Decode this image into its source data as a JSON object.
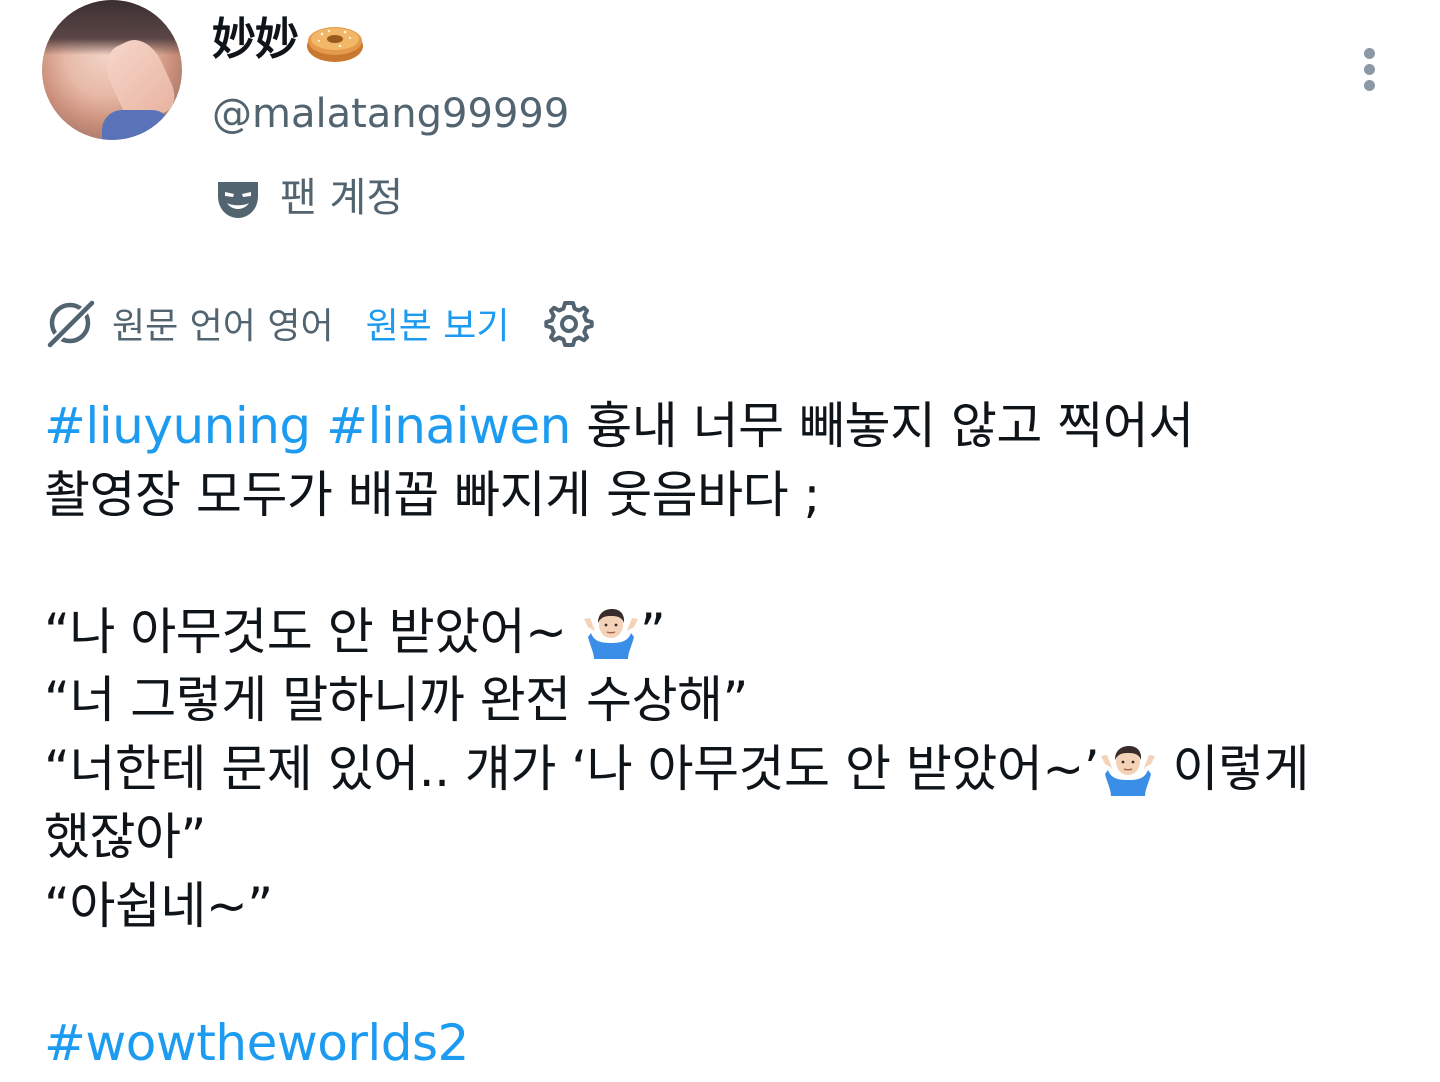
{
  "user": {
    "display_name": "妙妙",
    "display_name_emoji": "bagel-emoji",
    "handle": "@malatang99999",
    "badge_label": "팬 계정"
  },
  "translation": {
    "source_language": "원문 언어 영어",
    "view_original_label": "원본 보기"
  },
  "tweet": {
    "hashtag_1": "#liuyuning",
    "hashtag_2": "#linaiwen",
    "line_1_text": "흉내 너무 빼놓지 않고 찍어서",
    "line_2_text": "촬영장 모두가 배꼽 빠지게 웃음바다 ;",
    "quote_1_text": "“나 아무것도 안 받았어~ ",
    "quote_1_close": "”",
    "quote_2_text": "“너 그렇게 말하니까 완전 수상해”",
    "quote_3_text": "“너한테 문제 있어.. 걔가 ‘나 아무것도 안 받았어~’",
    "quote_3_tail": " 이렇게",
    "quote_3_cont": "했잖아”",
    "quote_4_text": "“아쉽네~”",
    "hashtag_3": "#wowtheworlds2"
  },
  "icons": {
    "emoji": "person-shrugging-emoji",
    "badge": "mask-icon",
    "translate": "globe-slash-icon",
    "settings": "gear-icon",
    "more": "more-vertical-icon"
  },
  "colors": {
    "link": "#1d9bf0",
    "secondary_text": "#536471",
    "primary_text": "#0f1419"
  }
}
